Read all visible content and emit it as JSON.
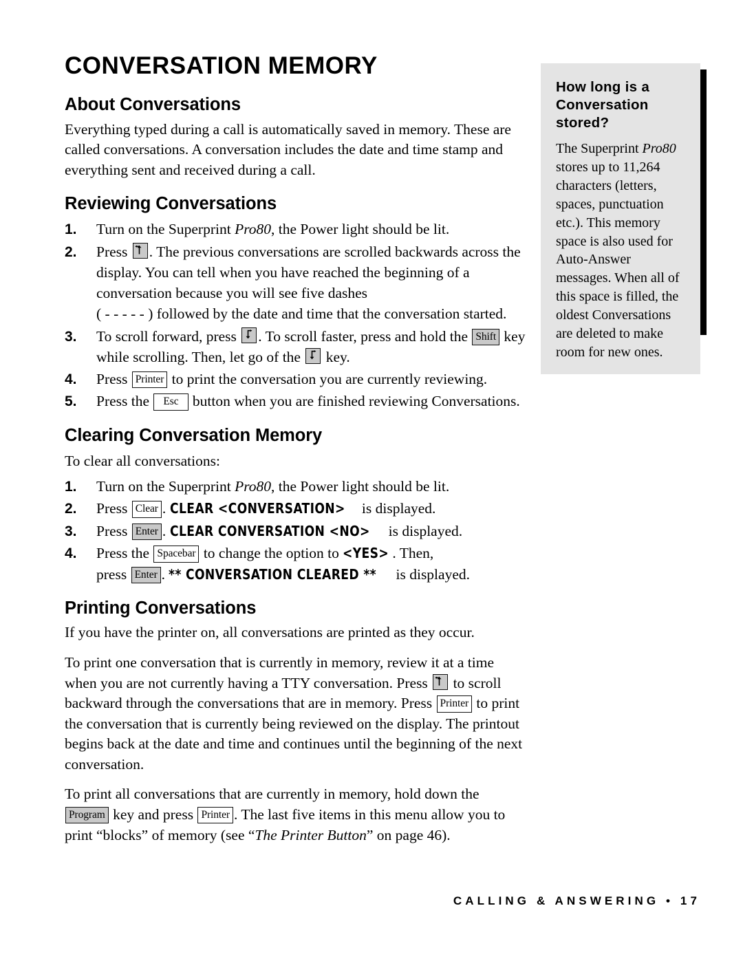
{
  "document": {
    "chapter_title": "CONVERSATION MEMORY"
  },
  "sections": {
    "about": {
      "heading": "About Conversations",
      "paragraph": "Everything typed during a call is automatically saved in memory. These are called conversations. A conversation includes the date and time stamp and everything sent and received during a call."
    },
    "reviewing": {
      "heading": "Reviewing Conversations",
      "steps": [
        {
          "number": "1.",
          "pre": "Turn on the Superprint ",
          "italic": "Pro80",
          "post": ", the Power light should be lit."
        },
        {
          "number": "2.",
          "pre": "Press ",
          "key": "scroll-back-arrow",
          "post": ". The previous conversations are scrolled backwards across the display. You can tell when you have reached the beginning of a conversation because you will see five dashes",
          "cont": "( - - - - - ) followed by the date and time that the conversation started."
        },
        {
          "number": "3.",
          "pre": "To scroll forward, press ",
          "key": "scroll-forward-arrow",
          "mid": ". To scroll faster, press and hold the ",
          "key2": "Shift",
          "mid2": " key while scrolling. Then, let go of the ",
          "key3": "scroll-forward-arrow",
          "post": " key."
        },
        {
          "number": "4.",
          "pre": "Press ",
          "key": "Printer",
          "post": " to print the conversation you are currently reviewing."
        },
        {
          "number": "5.",
          "pre": "Press the ",
          "key": "Esc",
          "post": " button when you are finished reviewing Conversations."
        }
      ]
    },
    "clearing": {
      "heading": "Clearing Conversation Memory",
      "intro": "To clear all conversations:",
      "steps": [
        {
          "number": "1.",
          "pre": "Turn on the Superprint ",
          "italic": "Pro80",
          "post": ", the Power light should be lit."
        },
        {
          "number": "2.",
          "pre": "Press ",
          "key": "Clear",
          "mid": ". ",
          "lcd": "CLEAR <CONVERSATION>",
          "post": " is displayed."
        },
        {
          "number": "3.",
          "pre": "Press ",
          "key": "Enter",
          "mid": ". ",
          "lcd": "CLEAR CONVERSATION <NO>",
          "post": " is displayed."
        },
        {
          "number": "4.",
          "pre": "Press the ",
          "key": "Spacebar",
          "mid": " to change the option to ",
          "lcd": "<YES>",
          "post": ". Then,",
          "cont_pre": "press ",
          "cont_key": "Enter",
          "cont_mid": ". ",
          "cont_lcd": "** CONVERSATION CLEARED **",
          "cont_post": " is displayed."
        }
      ]
    },
    "printing": {
      "heading": "Printing Conversations",
      "paragraph1": "If you have the printer on, all conversations are printed as they occur.",
      "paragraph2": {
        "part1": "To print one conversation that is currently in memory, review it at a time when you are not currently having a TTY conversation. Press ",
        "key1": "scroll-back-arrow",
        "part2": " to scroll backward through the conversations that are in memory. Press ",
        "key2": "Printer",
        "part3": " to print the conversation that is currently being reviewed on the display. The printout begins back at the date and time and continues until the beginning of the next conversation."
      },
      "paragraph3": {
        "part1": "To print all conversations that are currently in memory, hold down the ",
        "key1": "Program",
        "part2": " key and press ",
        "key2": "Printer",
        "part3": ". The last five items in this menu allow you to print “blocks” of memory (see “",
        "italic": "The Printer Button",
        "part4": "” on page 46)."
      }
    }
  },
  "sidebar": {
    "title": "How long is a Conversation stored?",
    "body_part1": "The Superprint ",
    "body_italic": "Pro80",
    "body_part2": " stores up to 11,264 characters (letters, spaces, punctuation etc.). This memory space is also used for Auto-Answer messages. When all of this space is filled, the oldest Conversations are deleted to make room for new ones.",
    "background_color": "#e4e4e4",
    "shadow_color": "#000000"
  },
  "footer": {
    "text": "CALLING & ANSWERING • 17"
  }
}
